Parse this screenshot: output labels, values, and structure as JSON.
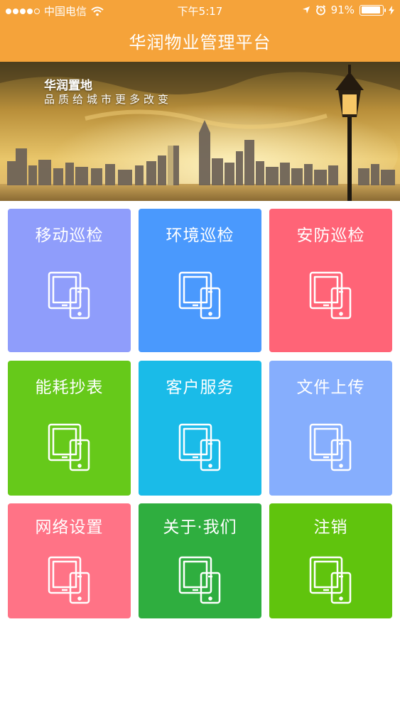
{
  "status_bar": {
    "carrier": "中国电信",
    "time": "下午5:17",
    "battery_percent": "91%",
    "battery_level": 0.91
  },
  "nav": {
    "title": "华润物业管理平台"
  },
  "banner": {
    "brand": "华润置地",
    "slogan": "品质给城市更多改变"
  },
  "tiles": [
    {
      "label": "移动巡检",
      "color": "#8f9dfb",
      "icon": "tablet-phone-icon"
    },
    {
      "label": "环境巡检",
      "color": "#4a99fd",
      "icon": "tablet-phone-icon"
    },
    {
      "label": "安防巡检",
      "color": "#ff6477",
      "icon": "tablet-phone-icon"
    },
    {
      "label": "能耗抄表",
      "color": "#66c91a",
      "icon": "tablet-phone-icon"
    },
    {
      "label": "客户服务",
      "color": "#1abbe8",
      "icon": "tablet-phone-icon"
    },
    {
      "label": "文件上传",
      "color": "#86aefd",
      "icon": "tablet-phone-icon"
    },
    {
      "label": "网络设置",
      "color": "#ff7386",
      "icon": "tablet-phone-icon"
    },
    {
      "label": "关于·我们",
      "color": "#2fae3f",
      "icon": "tablet-phone-icon"
    },
    {
      "label": "注销",
      "color": "#60c40d",
      "icon": "tablet-phone-icon"
    }
  ]
}
